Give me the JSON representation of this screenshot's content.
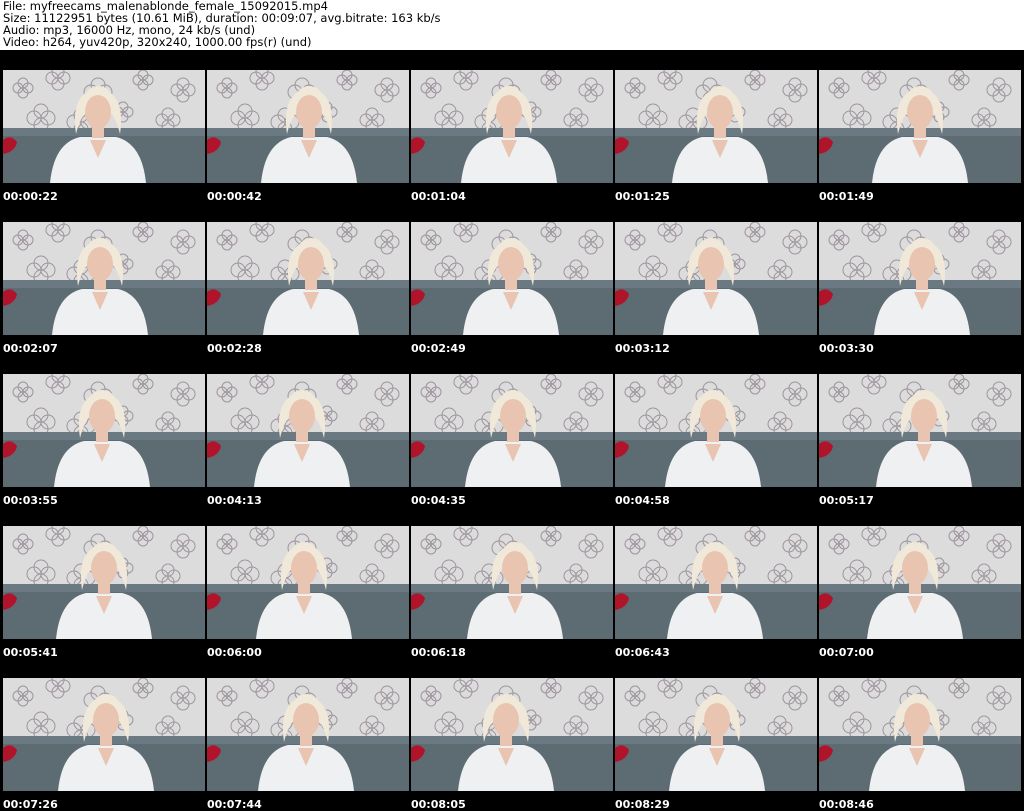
{
  "header": {
    "file": "File: myfreecams_malenablonde_female_15092015.mp4",
    "size": "Size: 11122951 bytes (10.61 MiB), duration: 00:09:07, avg.bitrate: 163 kb/s",
    "audio": "Audio: mp3, 16000 Hz, mono, 24 kb/s (und)",
    "video": "Video: h264, yuv420p, 320x240, 1000.00 fps(r) (und)"
  },
  "thumbnails": [
    {
      "time": "00:00:22"
    },
    {
      "time": "00:00:42"
    },
    {
      "time": "00:01:04"
    },
    {
      "time": "00:01:25"
    },
    {
      "time": "00:01:49"
    },
    {
      "time": "00:02:07"
    },
    {
      "time": "00:02:28"
    },
    {
      "time": "00:02:49"
    },
    {
      "time": "00:03:12"
    },
    {
      "time": "00:03:30"
    },
    {
      "time": "00:03:55"
    },
    {
      "time": "00:04:13"
    },
    {
      "time": "00:04:35"
    },
    {
      "time": "00:04:58"
    },
    {
      "time": "00:05:17"
    },
    {
      "time": "00:05:41"
    },
    {
      "time": "00:06:00"
    },
    {
      "time": "00:06:18"
    },
    {
      "time": "00:06:43"
    },
    {
      "time": "00:07:00"
    },
    {
      "time": "00:07:26"
    },
    {
      "time": "00:07:44"
    },
    {
      "time": "00:08:05"
    },
    {
      "time": "00:08:29"
    },
    {
      "time": "00:08:46"
    }
  ],
  "colors": {
    "background": "#000000",
    "header_bg": "#ffffff",
    "timestamp": "#ffffff",
    "wall": "#dcdcdc",
    "sofa": "#5d6b72",
    "shirt": "#eef0f2",
    "hair": "#f0e8d8",
    "skin": "#e9c4b0",
    "cushion": "#b0142a"
  }
}
